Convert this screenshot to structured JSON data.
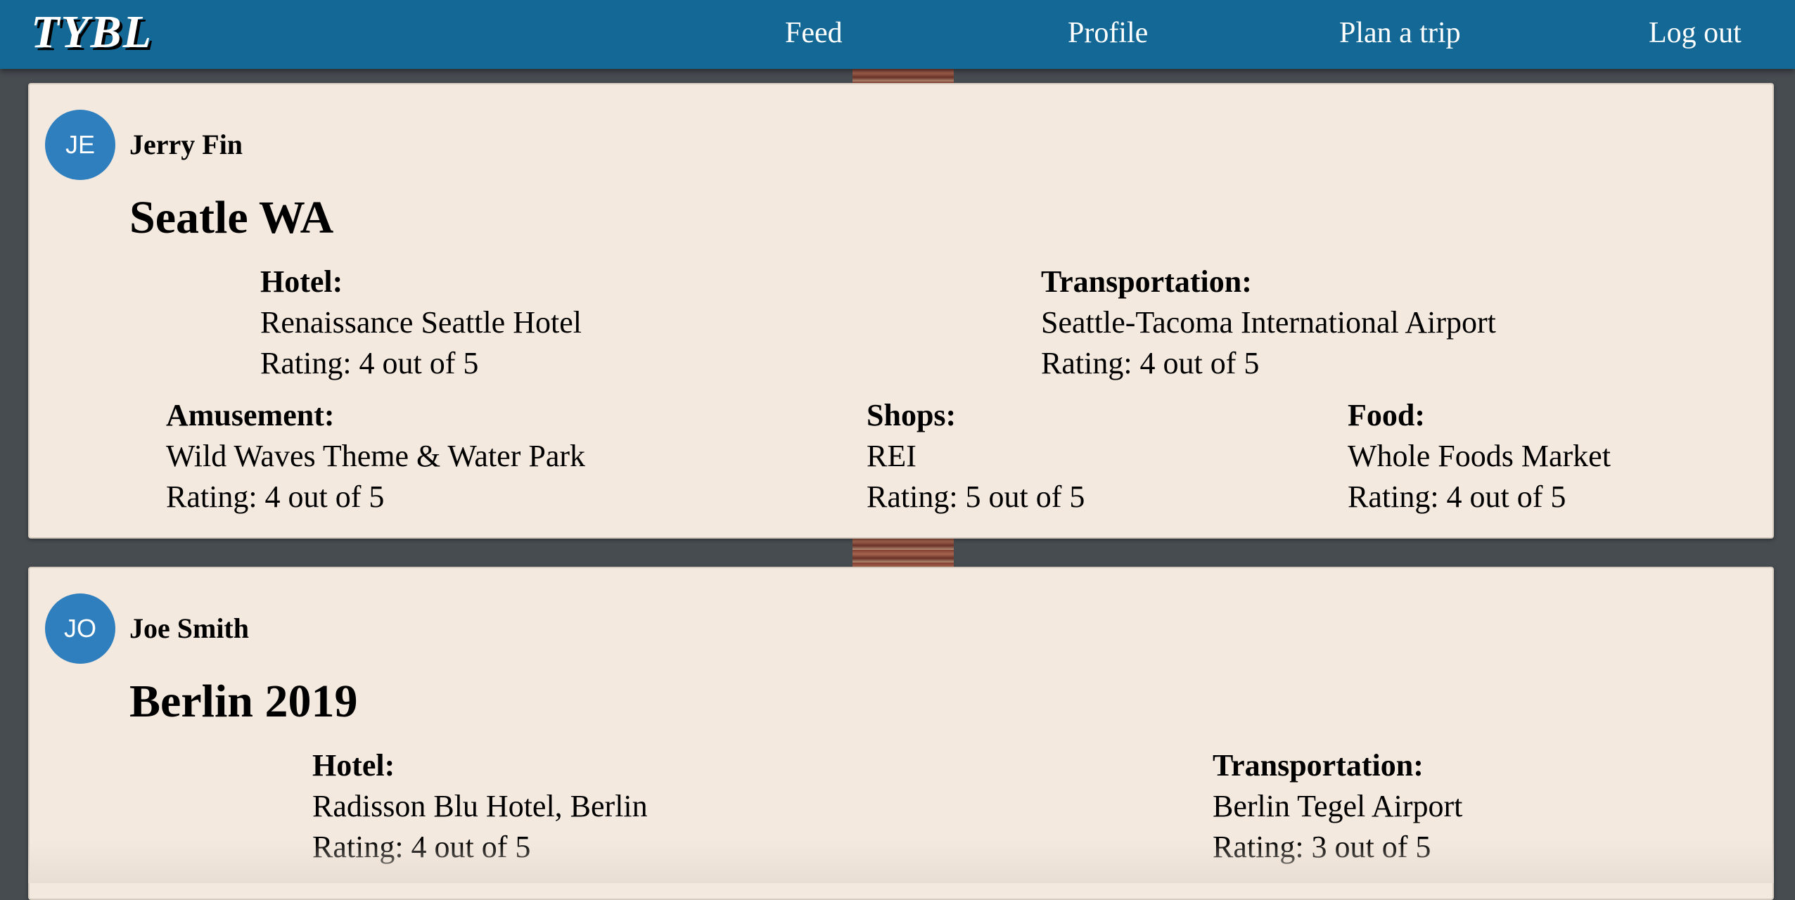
{
  "navbar": {
    "brand": "TYBL",
    "links": [
      "Feed",
      "Profile",
      "Plan a trip",
      "Log out"
    ]
  },
  "trips": [
    {
      "user_initials": "JE",
      "user_name": "Jerry Fin",
      "title": "Seatle WA",
      "categories": [
        {
          "label": "Hotel:",
          "name": "Renaissance Seattle Hotel",
          "rating": "Rating: 4 out of 5"
        },
        {
          "label": "Transportation:",
          "name": "Seattle-Tacoma International Airport",
          "rating": "Rating: 4 out of 5"
        },
        {
          "label": "Amusement:",
          "name": "Wild Waves Theme & Water Park",
          "rating": "Rating: 4 out of 5"
        },
        {
          "label": "Shops:",
          "name": "REI",
          "rating": "Rating: 5 out of 5"
        },
        {
          "label": "Food:",
          "name": "Whole Foods Market",
          "rating": "Rating: 4 out of 5"
        }
      ]
    },
    {
      "user_initials": "JO",
      "user_name": "Joe Smith",
      "title": "Berlin 2019",
      "categories": [
        {
          "label": "Hotel:",
          "name": "Radisson Blu Hotel, Berlin",
          "rating": "Rating: 4 out of 5"
        },
        {
          "label": "Transportation:",
          "name": "Berlin Tegel Airport",
          "rating": "Rating: 3 out of 5"
        }
      ]
    }
  ],
  "colors": {
    "navbar": "#136895",
    "card": "#f4e9de",
    "avatar": "#2f7fbf",
    "page_background": "#474c51"
  }
}
